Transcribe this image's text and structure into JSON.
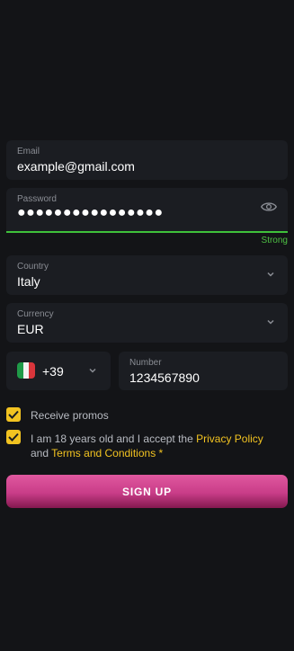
{
  "form": {
    "email": {
      "label": "Email",
      "value": "example@gmail.com"
    },
    "password": {
      "label": "Password",
      "value": "●●●●●●●●●●●●●●●●",
      "strength": "Strong"
    },
    "country": {
      "label": "Country",
      "value": "Italy"
    },
    "currency": {
      "label": "Currency",
      "value": "EUR"
    },
    "phone": {
      "code": "+39",
      "number_label": "Number",
      "number_value": "1234567890"
    },
    "promos": {
      "label": "Receive promos",
      "checked": true
    },
    "terms": {
      "text_before": "I am 18 years old and I accept the ",
      "privacy_link": "Privacy Policy",
      "text_middle": " and ",
      "terms_link": "Terms and Conditions",
      "required_mark": "*",
      "checked": true
    },
    "signup_label": "SIGN UP"
  },
  "colors": {
    "background": "#131417",
    "field_bg": "#1b1d22",
    "accent_yellow": "#f2c321",
    "strength_green": "#4ec144",
    "button_pink": "#c93d88"
  },
  "icons": {
    "password_toggle": "eye-icon",
    "dropdown": "chevron-down-icon",
    "checkbox": "check-icon",
    "flag": "italy-flag-icon"
  }
}
